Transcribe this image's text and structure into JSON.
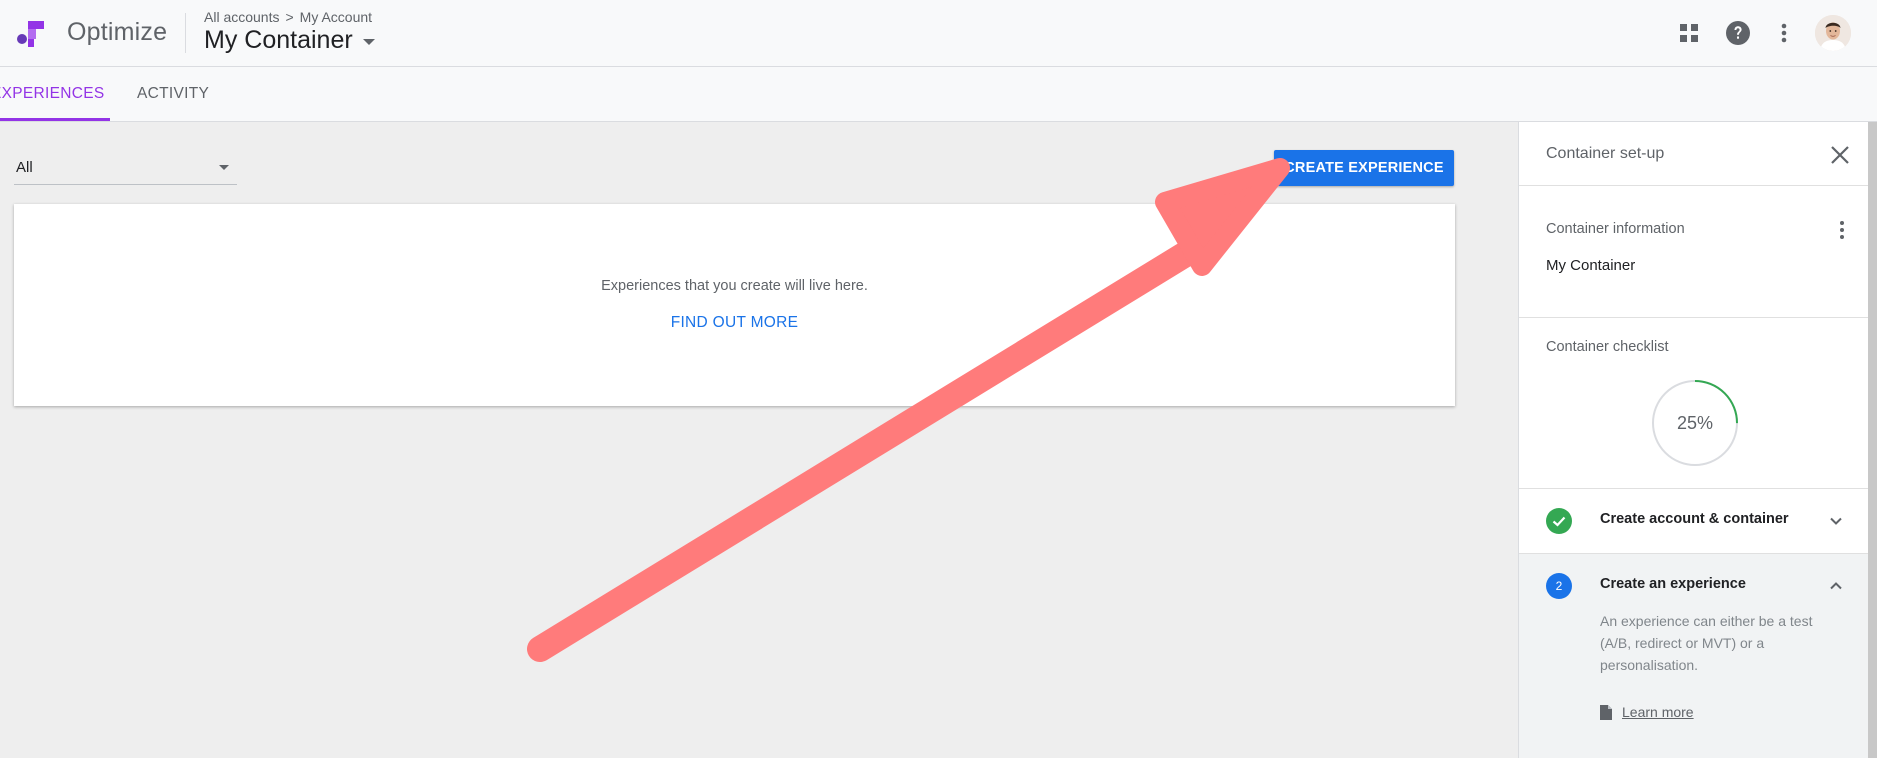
{
  "header": {
    "app_name": "Optimize",
    "breadcrumb": {
      "accounts": "All accounts",
      "separator": ">",
      "account": "My Account"
    },
    "container_name": "My Container",
    "icons": [
      "apps-grid-icon",
      "help-icon",
      "more-vert-icon"
    ]
  },
  "tabs": [
    {
      "label": "EXPERIENCES",
      "active": true
    },
    {
      "label": "ACTIVITY",
      "active": false
    }
  ],
  "main": {
    "filter": {
      "selected": "All"
    },
    "create_button": "CREATE EXPERIENCE",
    "empty_state": {
      "message": "Experiences that you create will live here.",
      "link": "FIND OUT MORE"
    }
  },
  "side_panel": {
    "title": "Container set-up",
    "info": {
      "label": "Container information",
      "value": "My Container"
    },
    "checklist": {
      "label": "Container checklist",
      "progress_text": "25%",
      "progress": 0.25
    },
    "steps": [
      {
        "number": "",
        "label": "Create account & container",
        "done": true,
        "expanded": false
      },
      {
        "number": "2",
        "label": "Create an experience",
        "done": false,
        "expanded": true,
        "description": "An experience can either be a test (A/B, redirect or MVT) or a personalisation.",
        "link": "Learn more"
      }
    ]
  },
  "colors": {
    "accent": "#9334e6",
    "primary": "#1a73e8",
    "success": "#34a853",
    "annotation_arrow": "#ff7b7b"
  }
}
